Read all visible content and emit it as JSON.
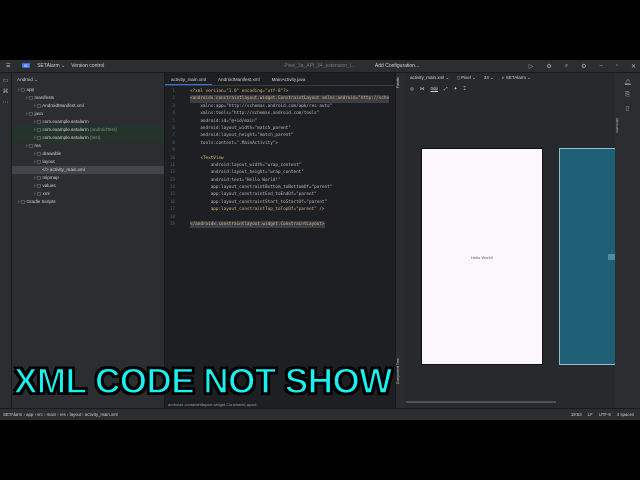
{
  "titlebar": {
    "project": "SETAlarm",
    "logo": "SE",
    "vcs": "Version control",
    "device": "Pixel_3a_API_34_extension_l...",
    "config": "Add Configuration..."
  },
  "project_panel": {
    "header": "Android",
    "tree": [
      {
        "label": "app",
        "indent": 0
      },
      {
        "label": "manifests",
        "indent": 1
      },
      {
        "label": "AndroidManifest.xml",
        "indent": 2
      },
      {
        "label": "java",
        "indent": 1
      },
      {
        "label": "com.example.setalarm",
        "indent": 2
      },
      {
        "label": "com.example.setalarm",
        "suffix": "(androidTest)",
        "indent": 2
      },
      {
        "label": "com.example.setalarm",
        "suffix": "(test)",
        "indent": 2
      },
      {
        "label": "res",
        "indent": 1
      },
      {
        "label": "drawable",
        "indent": 2
      },
      {
        "label": "layout",
        "indent": 2
      },
      {
        "label": "activity_main.xml",
        "indent": 3
      },
      {
        "label": "mipmap",
        "indent": 2
      },
      {
        "label": "values",
        "indent": 2
      },
      {
        "label": "xml",
        "indent": 2
      },
      {
        "label": "Gradle Scripts",
        "indent": 0
      }
    ]
  },
  "tabs": [
    "activity_main.xml",
    "AndroidManifest.xml",
    "MainActivity.java"
  ],
  "code": [
    "<?xml version=\"1.0\" encoding=\"utf-8\"?>",
    "<androidx.constraintlayout.widget.ConstraintLayout xmlns:android=\"http://sche",
    "    xmlns:app=\"http://schemas.android.com/apk/res-auto\"",
    "    xmlns:tools=\"http://schemas.android.com/tools\"",
    "    android:id=\"@+id/main\"",
    "    android:layout_width=\"match_parent\"",
    "    android:layout_height=\"match_parent\"",
    "    tools:context=\".MainActivity\">",
    "",
    "    <TextView",
    "        android:layout_width=\"wrap_content\"",
    "        android:layout_height=\"wrap_content\"",
    "        android:text=\"Hello World!\"",
    "        app:layout_constraintBottom_toBottomOf=\"parent\"",
    "        app:layout_constraintEnd_toEndOf=\"parent\"",
    "        app:layout_constraintStart_toStartOf=\"parent\"",
    "        app:layout_constraintTop_toTopOf=\"parent\" />",
    "",
    "</androidx.constraintlayout.widget.ConstraintLayout>"
  ],
  "breadcrumb_editor": "androidx.constraintlayout.widget.ConstraintLayout",
  "design": {
    "file": "activity_main.xml",
    "device": "Pixel",
    "api": "34",
    "theme": "SETAlarm",
    "dp": "0dp",
    "palette": "Palette",
    "component_tree": "Component Tree",
    "attributes": "Attributes",
    "preview_text": "Hello World!"
  },
  "status": {
    "path": [
      "SETAlarm",
      "app",
      "src",
      "main",
      "res",
      "layout",
      "activity_main.xml"
    ],
    "position": "19:53",
    "line_sep": "LF",
    "encoding": "UTF-8",
    "indent": "4 spaces"
  },
  "overlay": "XML CODE NOT SHOW"
}
